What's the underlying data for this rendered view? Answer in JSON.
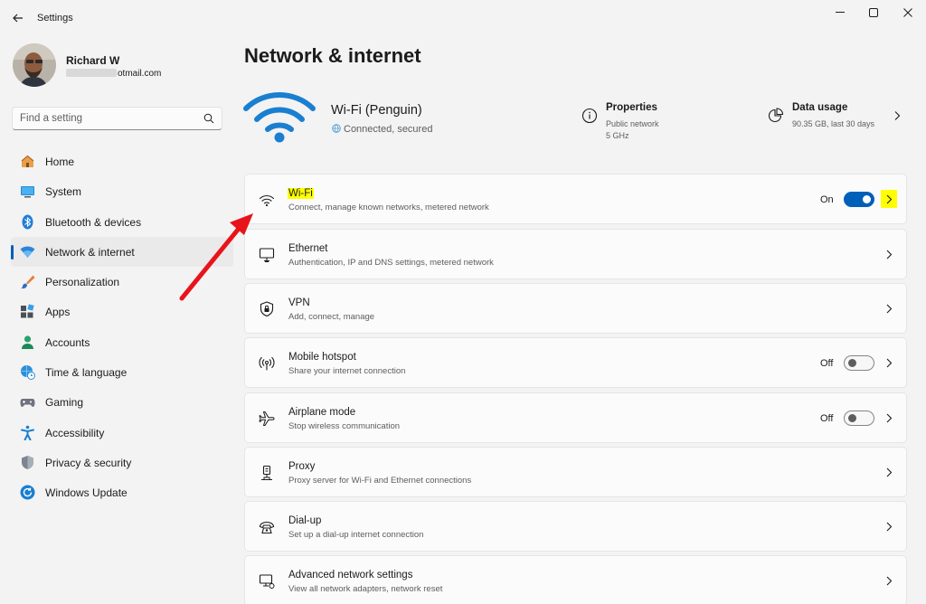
{
  "titlebar": {
    "app_title": "Settings",
    "icons": {
      "back": "back-arrow-icon",
      "minimize": "minimize-icon",
      "maximize": "maximize-icon",
      "close": "close-icon"
    }
  },
  "profile": {
    "name": "Richard W",
    "email_visible": "otmail.com"
  },
  "search": {
    "placeholder": "Find a setting",
    "value": ""
  },
  "sidebar": {
    "items": [
      {
        "label": "Home",
        "icon": "home-icon"
      },
      {
        "label": "System",
        "icon": "system-icon"
      },
      {
        "label": "Bluetooth & devices",
        "icon": "bluetooth-icon"
      },
      {
        "label": "Network & internet",
        "icon": "network-icon",
        "active": true
      },
      {
        "label": "Personalization",
        "icon": "brush-icon"
      },
      {
        "label": "Apps",
        "icon": "apps-icon"
      },
      {
        "label": "Accounts",
        "icon": "accounts-icon"
      },
      {
        "label": "Time & language",
        "icon": "globe-clock-icon"
      },
      {
        "label": "Gaming",
        "icon": "gamepad-icon"
      },
      {
        "label": "Accessibility",
        "icon": "accessibility-icon"
      },
      {
        "label": "Privacy & security",
        "icon": "shield-icon"
      },
      {
        "label": "Windows Update",
        "icon": "update-icon"
      }
    ]
  },
  "main": {
    "title": "Network & internet",
    "connection": {
      "name": "Wi-Fi (Penguin)",
      "status": "Connected, secured"
    },
    "properties": {
      "title": "Properties",
      "line1": "Public network",
      "line2": "5 GHz"
    },
    "data_usage": {
      "title": "Data usage",
      "detail": "90.35 GB, last 30 days"
    },
    "cards": [
      {
        "title": "Wi-Fi",
        "subtitle": "Connect, manage known networks, metered network",
        "icon": "wifi-icon",
        "toggle": "On",
        "toggle_on": true
      },
      {
        "title": "Ethernet",
        "subtitle": "Authentication, IP and DNS settings, metered network",
        "icon": "ethernet-icon"
      },
      {
        "title": "VPN",
        "subtitle": "Add, connect, manage",
        "icon": "vpn-shield-icon"
      },
      {
        "title": "Mobile hotspot",
        "subtitle": "Share your internet connection",
        "icon": "hotspot-icon",
        "toggle": "Off",
        "toggle_on": false
      },
      {
        "title": "Airplane mode",
        "subtitle": "Stop wireless communication",
        "icon": "airplane-icon",
        "toggle": "Off",
        "toggle_on": false
      },
      {
        "title": "Proxy",
        "subtitle": "Proxy server for Wi-Fi and Ethernet connections",
        "icon": "proxy-icon"
      },
      {
        "title": "Dial-up",
        "subtitle": "Set up a dial-up internet connection",
        "icon": "dialup-icon"
      },
      {
        "title": "Advanced network settings",
        "subtitle": "View all network adapters, network reset",
        "icon": "advanced-network-icon"
      }
    ]
  },
  "colors": {
    "accent": "#005fb8",
    "highlight": "#ffff00",
    "annotation_arrow": "#e8141b",
    "wifi_hero": "#1a7fd0"
  }
}
